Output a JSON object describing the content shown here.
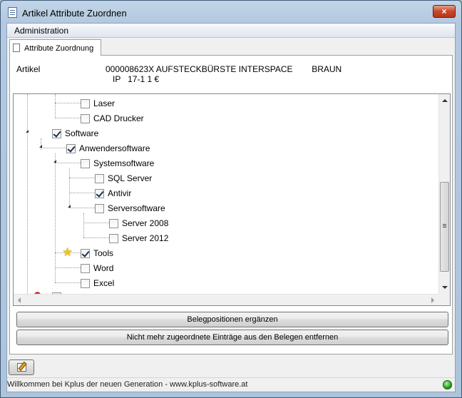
{
  "window": {
    "title": "Artikel Attribute Zuordnen",
    "close_glyph": "×"
  },
  "menu": {
    "items": [
      "Administration"
    ]
  },
  "tabs": [
    {
      "label": "Attribute Zuordnung",
      "active": true
    }
  ],
  "artikel": {
    "label": "Artikel",
    "line1": "000008623X AUFSTECKBÜRSTE INTERSPACE        BRAUN",
    "line2": "IP   17-1 1 €"
  },
  "tree": {
    "nodes": [
      {
        "label": "Laser",
        "checked": false
      },
      {
        "label": "CAD Drucker",
        "checked": false
      },
      {
        "label": "Software",
        "checked": true,
        "expanded": true
      },
      {
        "label": "Anwendersoftware",
        "checked": true,
        "expanded": true
      },
      {
        "label": "Systemsoftware",
        "checked": false,
        "expanded": true
      },
      {
        "label": "SQL Server",
        "checked": false
      },
      {
        "label": "Antivir",
        "checked": true
      },
      {
        "label": "Serversoftware",
        "checked": false,
        "expanded": true
      },
      {
        "label": "Server 2008",
        "checked": false
      },
      {
        "label": "Server 2012",
        "checked": false
      },
      {
        "label": "Tools",
        "checked": true,
        "icon": "star-icon"
      },
      {
        "label": "Word",
        "checked": false
      },
      {
        "label": "Excel",
        "checked": false
      }
    ]
  },
  "buttons": {
    "add_positions": "Belegpositionen ergänzen",
    "remove_entries": "Nicht mehr zugeordnete Einträge aus den Belegen entfernen"
  },
  "status": {
    "text": "Willkommen bei Kplus der neuen Generation - www.kplus-software.at",
    "led_color": "#22a31a"
  }
}
